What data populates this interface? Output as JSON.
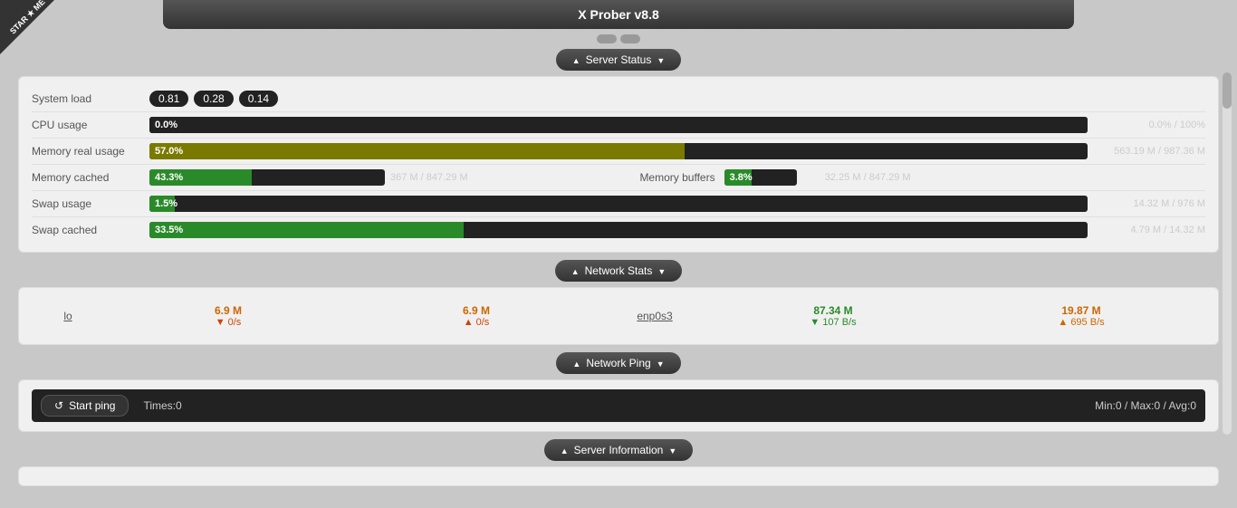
{
  "app": {
    "title": "X Prober v8.8",
    "logo": "STAR ★ ME"
  },
  "minimize_buttons": [
    "btn1",
    "btn2"
  ],
  "server_status": {
    "toggle_label": "Server Status",
    "system_load": {
      "label": "System load",
      "values": [
        "0.81",
        "0.28",
        "0.14"
      ]
    },
    "cpu_usage": {
      "label": "CPU usage",
      "percent": "0.0%",
      "range": "0.0% / 100%"
    },
    "memory_real": {
      "label": "Memory real usage",
      "percent": "57.0%",
      "range": "563.19 M / 987.36 M"
    },
    "memory_cached": {
      "label": "Memory cached",
      "percent": "43.3%",
      "mid": "367 M / 847.29 M",
      "buffers_label": "Memory buffers",
      "buffers_percent": "3.8%",
      "buffers_range": "32.25 M / 847.29 M"
    },
    "swap_usage": {
      "label": "Swap usage",
      "percent": "1.5%",
      "range": "14.32 M / 976 M"
    },
    "swap_cached": {
      "label": "Swap cached",
      "percent": "33.5%",
      "range": "4.79 M / 14.32 M"
    }
  },
  "network_stats": {
    "toggle_label": "Network Stats",
    "interfaces": [
      {
        "name": "lo",
        "rx_total": "6.9 M",
        "rx_rate": "0/s",
        "rx_dir": "down",
        "tx_total": "6.9 M",
        "tx_rate": "0/s",
        "tx_dir": "up"
      },
      {
        "name": "enp0s3",
        "rx_total": "87.34 M",
        "rx_rate": "107 B/s",
        "rx_dir": "down",
        "tx_total": "19.87 M",
        "tx_rate": "695 B/s",
        "tx_dir": "up"
      }
    ]
  },
  "network_ping": {
    "toggle_label": "Network Ping",
    "start_label": "Start ping",
    "times_label": "Times:0",
    "stats_label": "Min:0 / Max:0 / Avg:0"
  },
  "server_information": {
    "toggle_label": "Server Information"
  }
}
